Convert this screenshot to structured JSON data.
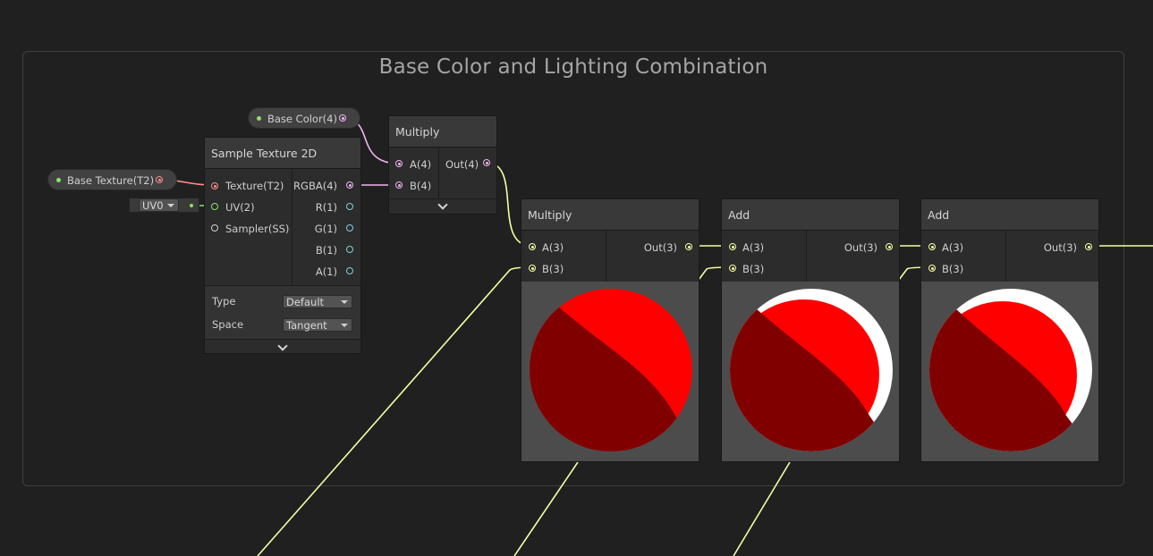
{
  "group": {
    "title": "Base Color and Lighting Combination"
  },
  "properties": {
    "base_color": {
      "label": "Base Color(4)"
    },
    "base_texture": {
      "label": "Base Texture(T2)"
    }
  },
  "uv_dropdown": {
    "value": "UV0"
  },
  "sample_texture": {
    "title": "Sample Texture 2D",
    "inputs": [
      "Texture(T2)",
      "UV(2)",
      "Sampler(SS)"
    ],
    "outputs": [
      "RGBA(4)",
      "R(1)",
      "G(1)",
      "B(1)",
      "A(1)"
    ],
    "type_label": "Type",
    "type_value": "Default",
    "space_label": "Space",
    "space_value": "Tangent"
  },
  "multiply_1": {
    "title": "Multiply",
    "in_a": "A(4)",
    "in_b": "B(4)",
    "out": "Out(4)"
  },
  "multiply_2": {
    "title": "Multiply",
    "in_a": "A(3)",
    "in_b": "B(3)",
    "out": "Out(3)"
  },
  "add_1": {
    "title": "Add",
    "in_a": "A(3)",
    "in_b": "B(3)",
    "out": "Out(3)"
  },
  "add_2": {
    "title": "Add",
    "in_a": "A(3)",
    "in_b": "B(3)",
    "out": "Out(3)"
  },
  "colors": {
    "background": "#202020",
    "wire_vector4": "#f0b4f0",
    "wire_texture": "#ff8a8a",
    "wire_vector3": "#f6ffa0",
    "wire_vector2": "#8ee06a",
    "sphere_lit": "#ff0000",
    "sphere_shadow": "#7f0000",
    "sphere_highlight": "#ffffff"
  },
  "icons": [
    "chevron-down-icon",
    "dropdown-arrow-icon",
    "port-dot-icon"
  ]
}
